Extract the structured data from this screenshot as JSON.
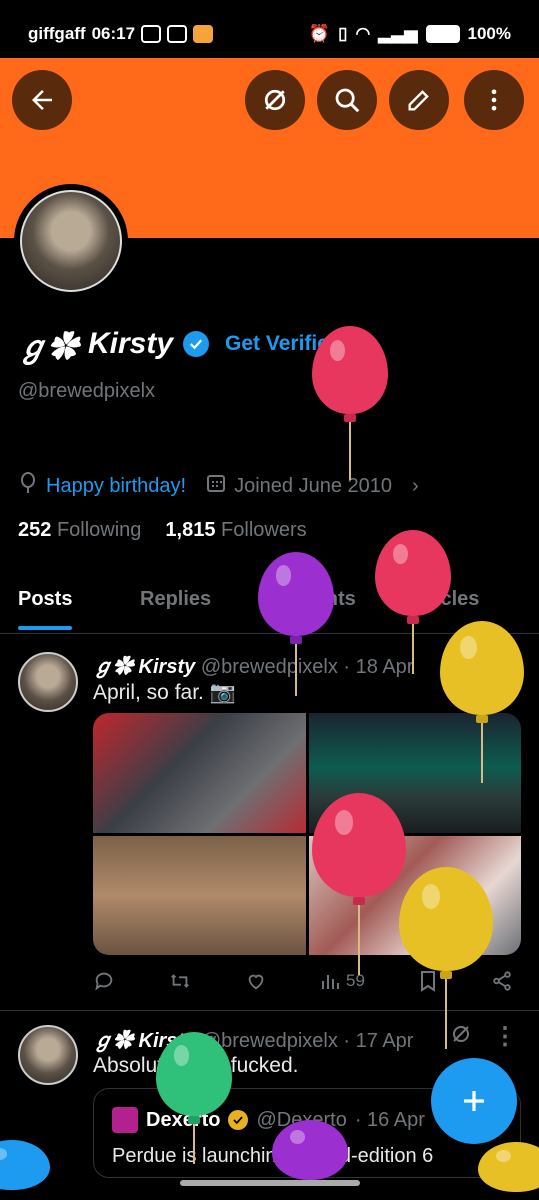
{
  "status_bar": {
    "carrier": "giffgaff",
    "time": "06:17",
    "battery": "100%"
  },
  "profile": {
    "name": "Kirsty",
    "name_prefix": "ℊ✿",
    "get_verified": "Get Verified",
    "handle": "@brewedpixelx",
    "birthday": "Happy birthday!",
    "joined": "Joined June 2010",
    "following_count": "252",
    "following_label": "Following",
    "followers_count": "1,815",
    "followers_label": "Followers"
  },
  "tabs": [
    "Posts",
    "Replies",
    "Highlights",
    "Articles"
  ],
  "posts": [
    {
      "name": "ℊ✿ Kirsty",
      "handle": "@brewedpixelx",
      "date": "· 18 Apr",
      "text": "April, so far. 📷",
      "views": "59"
    },
    {
      "name": "ℊ✿ Kirsty",
      "handle": "@brewedpixelx",
      "date": "· 17 Apr",
      "text": "Absolutely get fucked.",
      "quote": {
        "name": "Dexerto",
        "handle": "@Dexerto",
        "date": "· 16 Apr",
        "text": "Perdue is launching limited-edition 6"
      }
    }
  ],
  "colors": {
    "banner": "#ff6a1a",
    "accent": "#1d9bf0",
    "background": "#000000"
  }
}
